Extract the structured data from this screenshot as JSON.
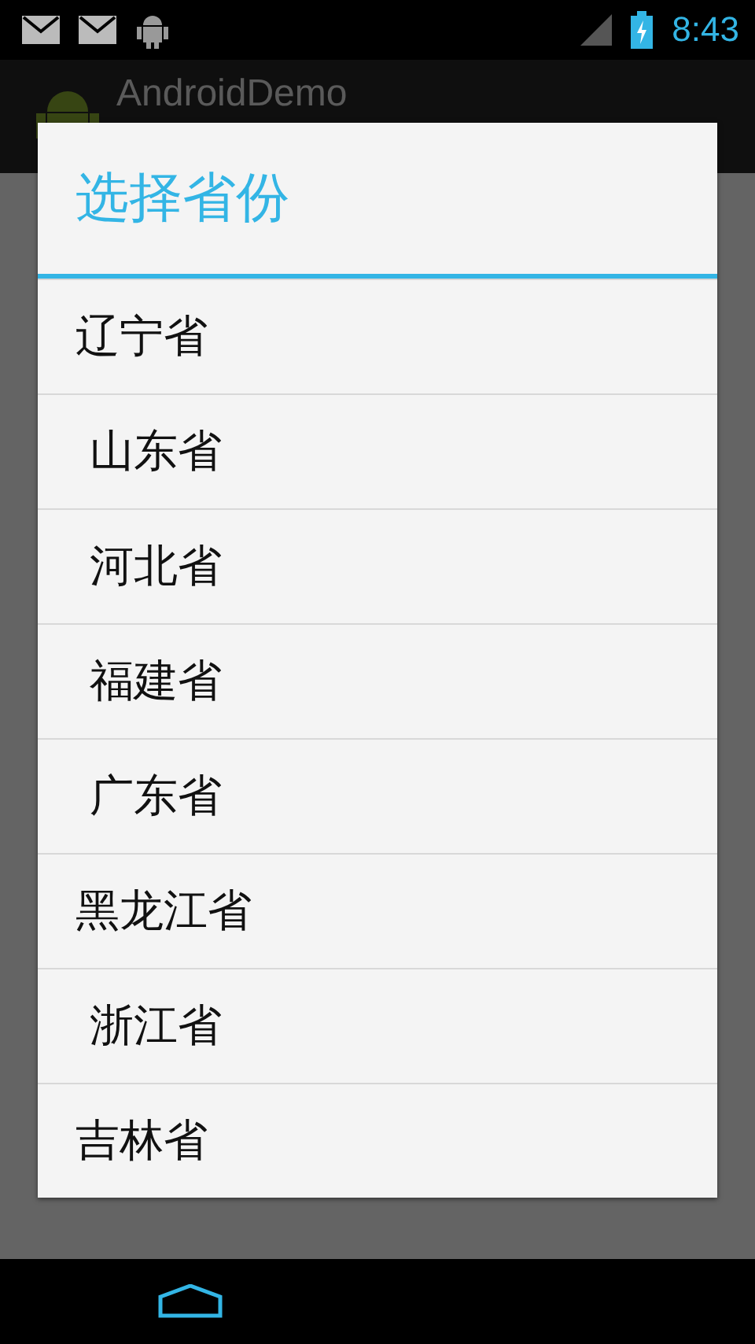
{
  "status_bar": {
    "time": "8:43"
  },
  "action_bar": {
    "title": "AndroidDemo"
  },
  "dialog": {
    "title": "选择省份",
    "items": [
      {
        "label": "辽宁省"
      },
      {
        "label": " 山东省"
      },
      {
        "label": " 河北省"
      },
      {
        "label": " 福建省"
      },
      {
        "label": " 广东省"
      },
      {
        "label": "黑龙江省"
      },
      {
        "label": " 浙江省"
      },
      {
        "label": "吉林省"
      }
    ]
  }
}
